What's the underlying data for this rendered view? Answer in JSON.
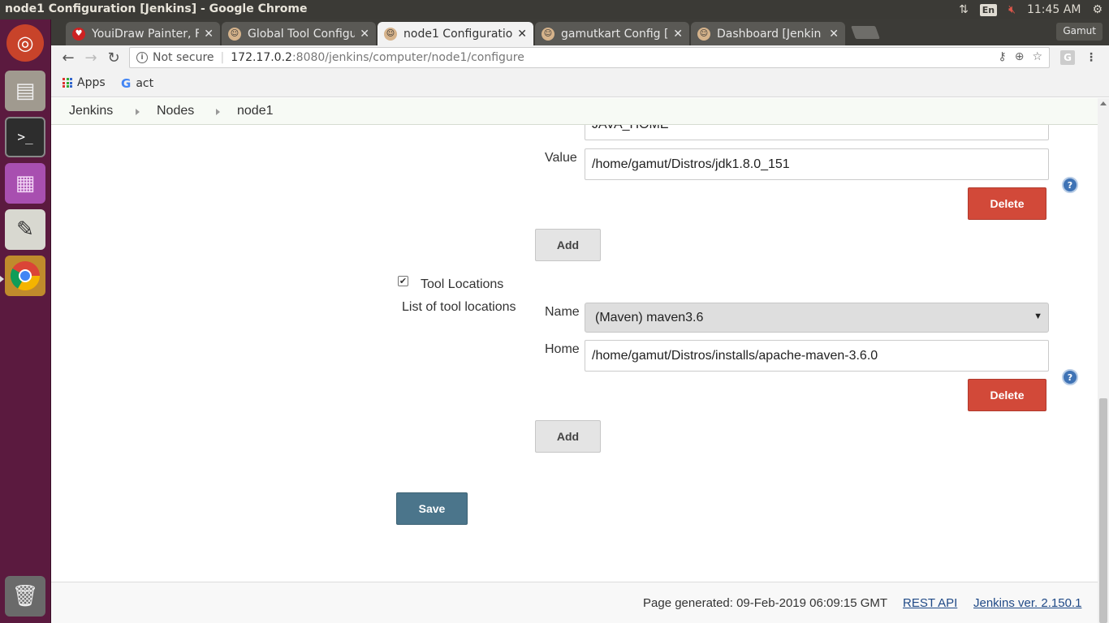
{
  "os_panel": {
    "window_title": "node1 Configuration [Jenkins] - Google Chrome",
    "keyboard_lang": "En",
    "clock": "11:45 AM"
  },
  "launcher": {
    "items": [
      "ubuntu-dash",
      "files",
      "terminal",
      "workspace-switcher",
      "text-editor",
      "chrome",
      "trash"
    ]
  },
  "browser": {
    "tabs": [
      {
        "label": "YouiDraw Painter, F",
        "icon": "youidraw-icon"
      },
      {
        "label": "Global Tool Configu",
        "icon": "jenkins-icon"
      },
      {
        "label": "node1 Configuratio",
        "icon": "jenkins-icon",
        "active": true
      },
      {
        "label": "gamutkart Config [",
        "icon": "jenkins-icon"
      },
      {
        "label": "Dashboard [Jenkin",
        "icon": "jenkins-icon"
      }
    ],
    "profile": "Gamut",
    "address": {
      "security": "Not secure",
      "host": "172.17.0.2",
      "path": ":8080/jenkins/computer/node1/configure"
    },
    "bookmarks": {
      "apps": "Apps",
      "act": "act"
    }
  },
  "breadcrumbs": [
    "Jenkins",
    "Nodes",
    "node1"
  ],
  "env_var": {
    "name_value": "JAVA_HOME",
    "value_label": "Value",
    "value": "/home/gamut/Distros/jdk1.8.0_151",
    "delete_label": "Delete",
    "add_label": "Add"
  },
  "tool_locations": {
    "checkbox_label": "Tool Locations",
    "checked": true,
    "list_label": "List of tool locations",
    "name_label": "Name",
    "name_selected": "(Maven) maven3.6",
    "home_label": "Home",
    "home_value": "/home/gamut/Distros/installs/apache-maven-3.6.0",
    "delete_label": "Delete",
    "add_label": "Add"
  },
  "save_label": "Save",
  "footer": {
    "generated": "Page generated: 09-Feb-2019 06:09:15 GMT",
    "rest_api": "REST API",
    "version": "Jenkins ver. 2.150.1"
  }
}
